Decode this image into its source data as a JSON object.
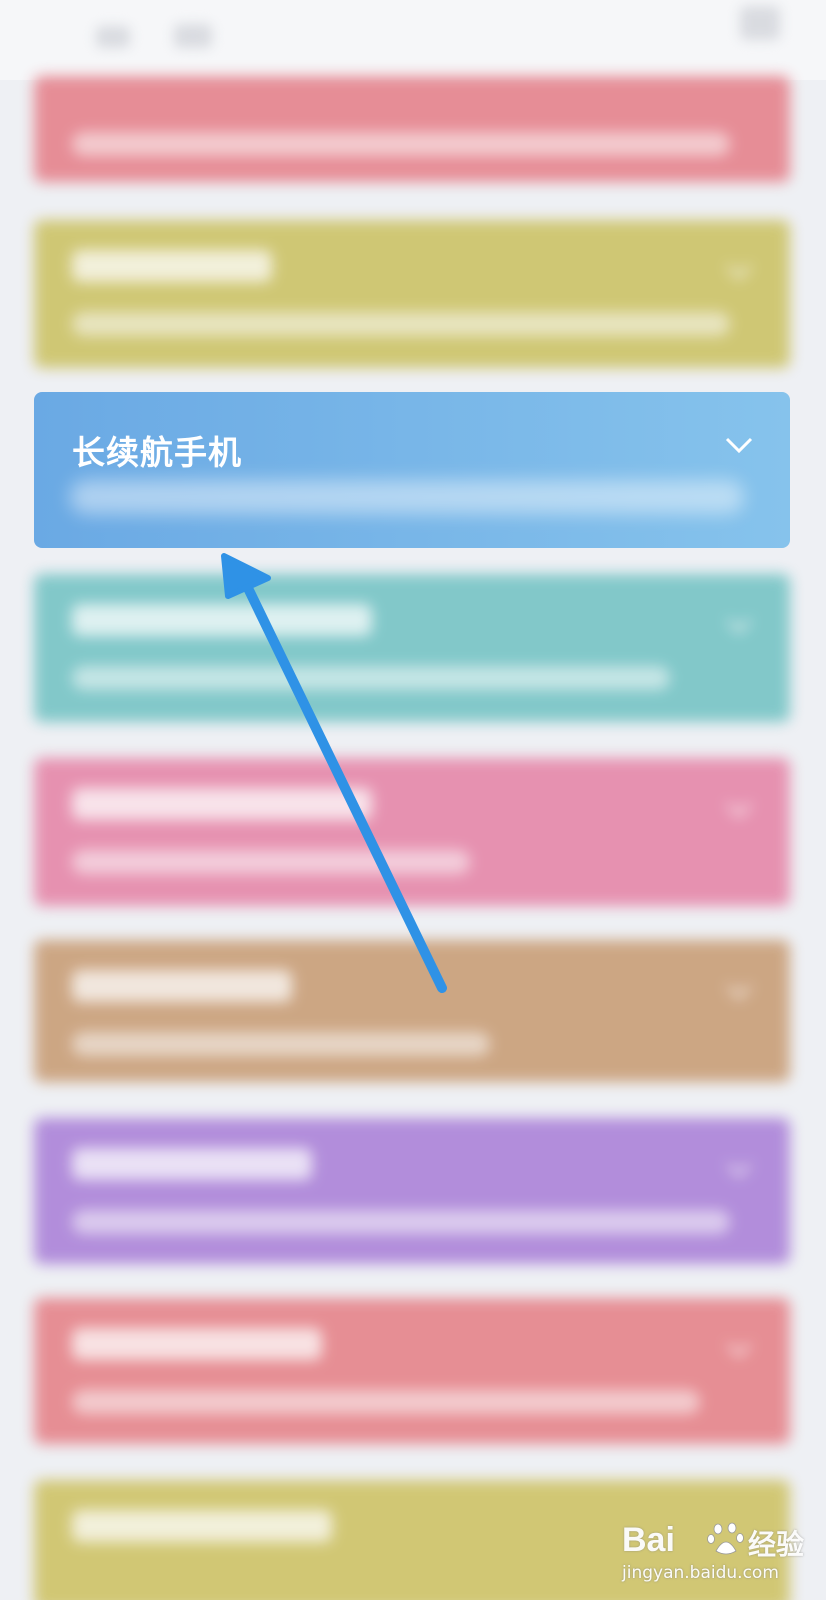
{
  "focused_card": {
    "title": "长续航手机",
    "color_start": "#6aa9e4",
    "color_end": "#86c3ec",
    "icon": "chevron-down-icon"
  },
  "blurred_cards_colors": [
    "#e6858f",
    "#cdc46a",
    "#79c5c6",
    "#e68aab",
    "#caa07a",
    "#ad85d9",
    "#e6868c",
    "#cfc46a"
  ],
  "annotation": {
    "arrow_color": "#2f92e6"
  },
  "watermark": {
    "logo": "Bai",
    "brand": "经验",
    "url": "jingyan.baidu.com"
  }
}
